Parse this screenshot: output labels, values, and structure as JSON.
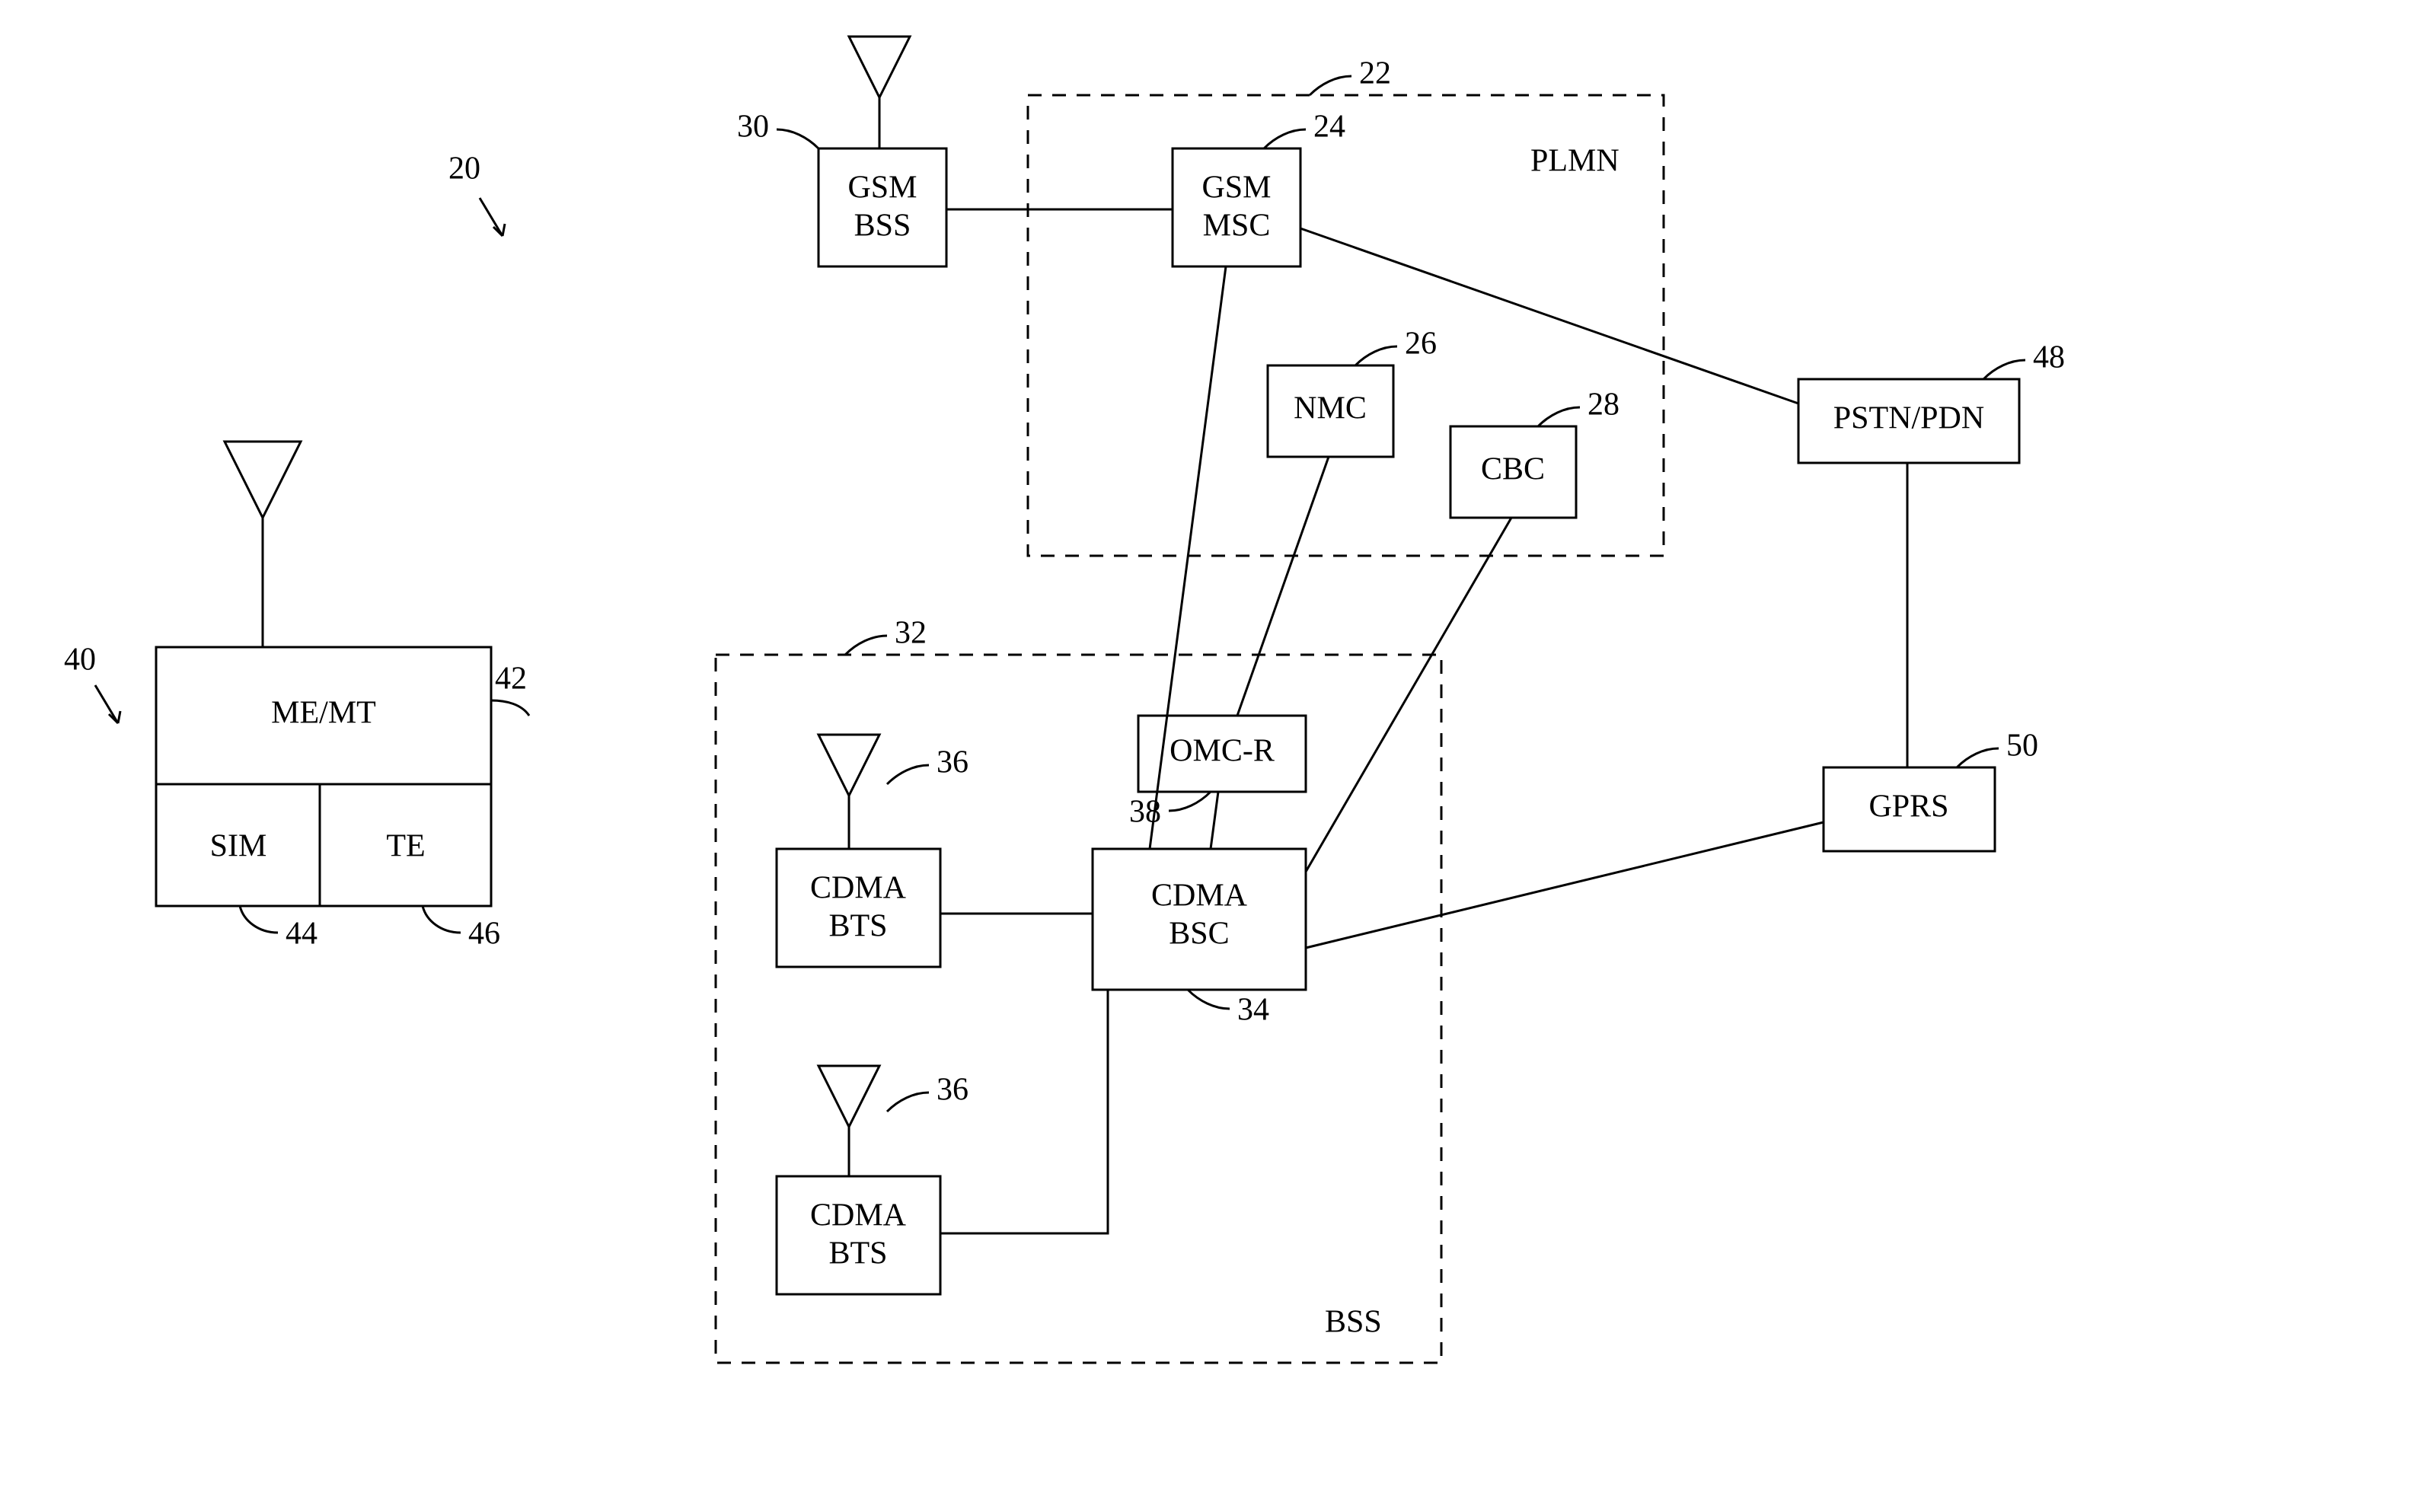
{
  "figure": {
    "ref_overall": "20",
    "ref_ms": "40"
  },
  "plmn": {
    "label": "PLMN",
    "ref": "22",
    "gsm_msc": {
      "line1": "GSM",
      "line2": "MSC",
      "ref": "24"
    },
    "nmc": {
      "label": "NMC",
      "ref": "26"
    },
    "cbc": {
      "label": "CBC",
      "ref": "28"
    }
  },
  "gsm_bss": {
    "line1": "GSM",
    "line2": "BSS",
    "ref": "30"
  },
  "bss": {
    "label": "BSS",
    "ref": "32",
    "cdma_bsc": {
      "line1": "CDMA",
      "line2": "BSC",
      "ref": "34"
    },
    "cdma_bts": {
      "line1": "CDMA",
      "line2": "BTS",
      "ref": "36"
    },
    "omc_r": {
      "label": "OMC-R",
      "ref": "38"
    }
  },
  "ms": {
    "me_mt": {
      "label": "ME/MT",
      "ref": "42"
    },
    "sim": {
      "label": "SIM",
      "ref": "44"
    },
    "te": {
      "label": "TE",
      "ref": "46"
    }
  },
  "pstn": {
    "label": "PSTN/PDN",
    "ref": "48"
  },
  "gprs": {
    "label": "GPRS",
    "ref": "50"
  }
}
